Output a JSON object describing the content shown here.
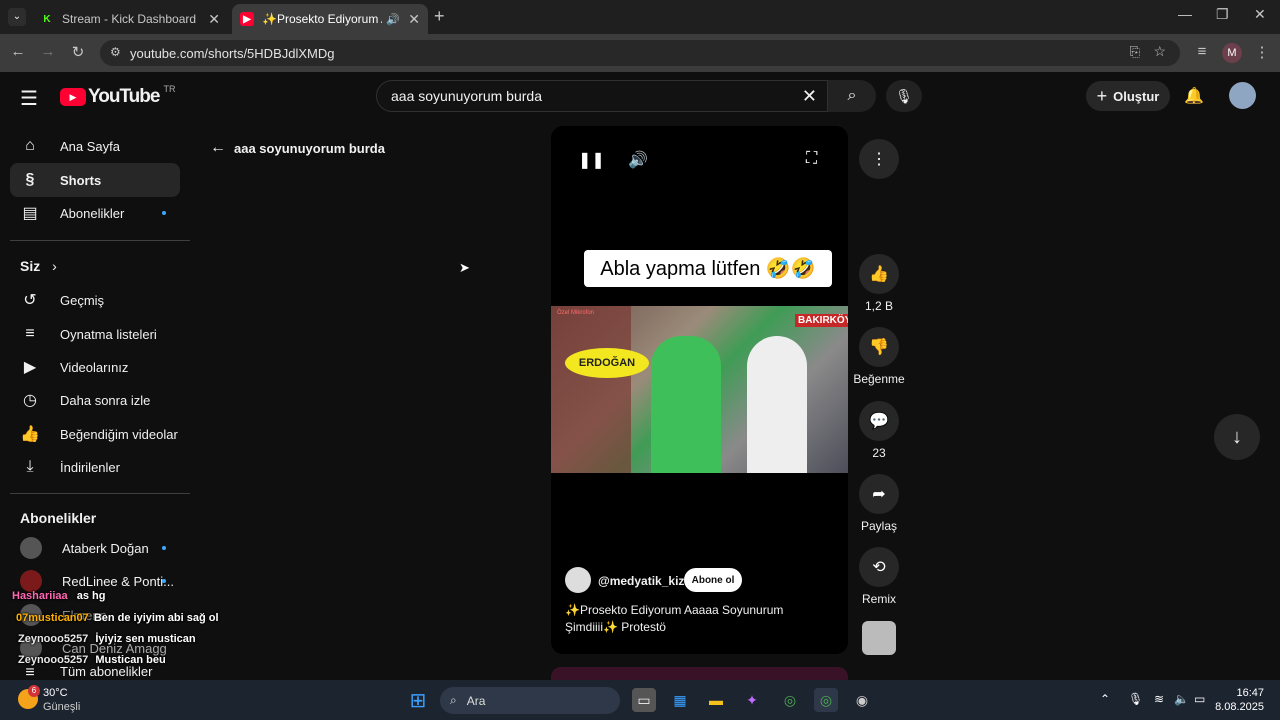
{
  "browser": {
    "tabs": [
      {
        "title": "Stream - Kick Dashboard"
      },
      {
        "title": "✨Prosekto Ediyorum Aaaa"
      }
    ],
    "url": "youtube.com/shorts/5HDBJdlXMDg",
    "profile_initial": "M"
  },
  "youtube": {
    "logo": "YouTube",
    "region": "TR",
    "search_query": "aaa soyunuyorum burda",
    "create_label": "Oluştur",
    "back_label": "aaa soyunuyorum burda",
    "sidebar": {
      "main": [
        "Ana Sayfa",
        "Shorts",
        "Abonelikler"
      ],
      "you_header": "Siz",
      "you_items": [
        "Geçmiş",
        "Oynatma listeleri",
        "Videolarınız",
        "Daha sonra izle",
        "Beğendiğim videolar",
        "İndirilenler"
      ],
      "subs_header": "Abonelikler",
      "subs": [
        "Ataberk Doğan",
        "RedLinee & Ponti...",
        "Elraenn",
        "Can Deniz Amagg",
        "Tüm abonelikler"
      ]
    },
    "short": {
      "overlay_text": "Abla yapma lütfen 🤣🤣",
      "channel": "@medyatik_kiz",
      "subscribe_label": "Abone ol",
      "title": "✨Prosekto Ediyorum Aaaaa Soyunurum Şimdiiii✨ Protestö",
      "video_labels": {
        "speech": "ERDOĞAN",
        "location": "BAKIRKÖY",
        "logo": "Özel Mikrofon"
      }
    },
    "actions": {
      "like_count": "1,2 B",
      "dislike_label": "Beğenme",
      "comment_count": "23",
      "share_label": "Paylaş",
      "remix_label": "Remix"
    }
  },
  "chat": [
    {
      "user": "Hashariiaa",
      "msg": "as hg",
      "color": "#ff69b4"
    },
    {
      "user": "07mustican07",
      "msg": "Ben de iyiyim abi sağ ol",
      "color": "#ffb000"
    },
    {
      "user": "Zeynooo5257",
      "msg": "İyiyiz sen mustican",
      "color": "#e8e8e8"
    },
    {
      "user": "Zeynooo5257",
      "msg": "Mustican beu",
      "color": "#e8e8e8"
    }
  ],
  "taskbar": {
    "weather_temp": "30°C",
    "weather_desc": "Güneşli",
    "weather_badge": "6",
    "search_label": "Ara",
    "time": "16:47",
    "date": "8.08.2025"
  }
}
